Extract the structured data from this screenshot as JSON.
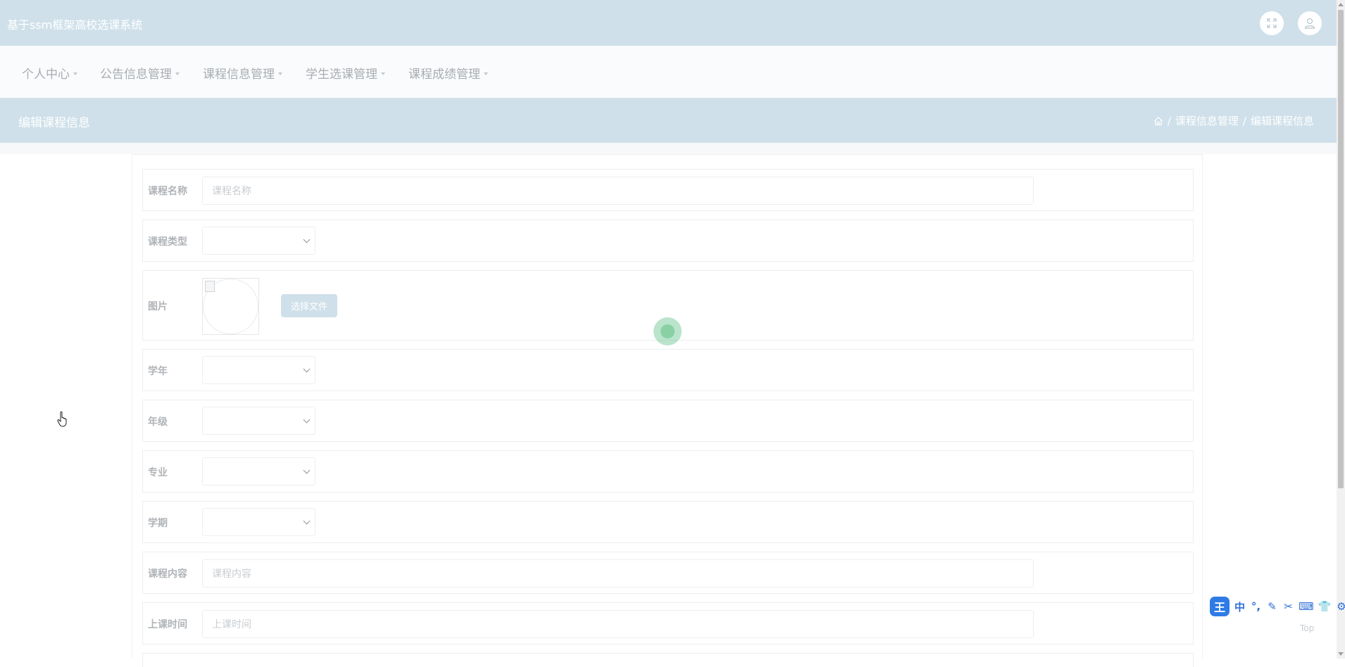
{
  "header": {
    "app_title": "基于ssm框架高校选课系统",
    "fullscreen_icon": "fullscreen-icon",
    "user_icon": "user-icon"
  },
  "menu": {
    "items": [
      {
        "label": "个人中心"
      },
      {
        "label": "公告信息管理"
      },
      {
        "label": "课程信息管理"
      },
      {
        "label": "学生选课管理"
      },
      {
        "label": "课程成绩管理"
      }
    ]
  },
  "title_bar": {
    "page_title": "编辑课程信息",
    "breadcrumb": {
      "home_icon": "home-icon",
      "separator": "/",
      "items": [
        "课程信息管理",
        "编辑课程信息"
      ]
    }
  },
  "form": {
    "course_name": {
      "label": "课程名称",
      "placeholder": "课程名称",
      "value": ""
    },
    "course_type": {
      "label": "课程类型",
      "value": ""
    },
    "image": {
      "label": "图片",
      "button_label": "选择文件"
    },
    "school_year": {
      "label": "学年",
      "value": ""
    },
    "grade": {
      "label": "年级",
      "value": ""
    },
    "major": {
      "label": "专业",
      "value": ""
    },
    "semester": {
      "label": "学期",
      "value": ""
    },
    "course_content": {
      "label": "课程内容",
      "placeholder": "课程内容",
      "value": ""
    },
    "class_time": {
      "label": "上课时间",
      "placeholder": "上课时间",
      "value": ""
    }
  },
  "ime_toolbar": {
    "logo": "王",
    "items": [
      "中",
      "°,",
      "✎",
      "✂",
      "⌨",
      "👕",
      "⚙"
    ]
  },
  "back_to_top": {
    "label": "Top"
  },
  "colors": {
    "header_bg": "#cfe0ea",
    "menu_bg": "#fafbfc",
    "loader": "#8ad0a5",
    "ime_blue": "#2f7be6"
  }
}
